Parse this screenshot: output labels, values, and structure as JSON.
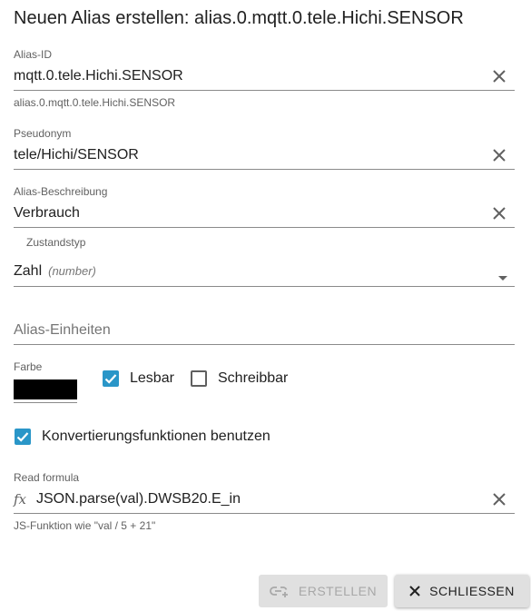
{
  "dialog": {
    "title": "Neuen Alias erstellen: alias.0.mqtt.0.tele.Hichi.SENSOR"
  },
  "alias_id": {
    "label": "Alias-ID",
    "value": "mqtt.0.tele.Hichi.SENSOR",
    "helper": "alias.0.mqtt.0.tele.Hichi.SENSOR"
  },
  "pseudonym": {
    "label": "Pseudonym",
    "value": "tele/Hichi/SENSOR"
  },
  "description": {
    "label": "Alias-Beschreibung",
    "value": "Verbrauch"
  },
  "state_type": {
    "label": "Zustandstyp",
    "value": "Zahl",
    "hint": "(number)"
  },
  "units": {
    "placeholder": "Alias-Einheiten"
  },
  "color": {
    "label": "Farbe",
    "value": "#000000"
  },
  "readable": {
    "label": "Lesbar",
    "checked": true
  },
  "writable": {
    "label": "Schreibbar",
    "checked": false
  },
  "conversion": {
    "label": "Konvertierungsfunktionen benutzen",
    "checked": true
  },
  "read_formula": {
    "label": "Read formula",
    "value": "JSON.parse(val).DWSB20.E_in",
    "helper": "JS-Funktion wie \"val / 5 + 21\""
  },
  "buttons": {
    "create": "ERSTELLEN",
    "close": "SCHLIESSEN"
  },
  "colors": {
    "accent": "#2a96c8",
    "button_bg": "#e0e0e0"
  }
}
